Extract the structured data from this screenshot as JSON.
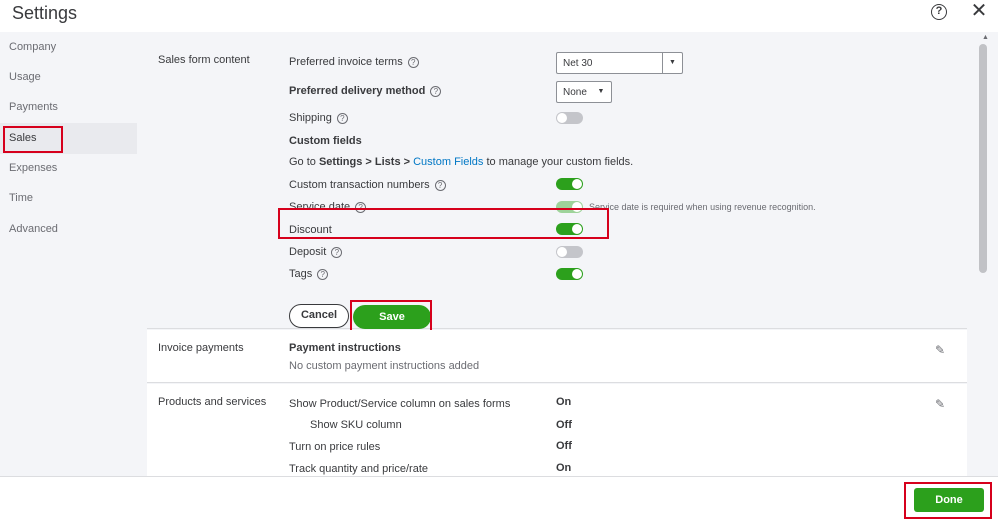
{
  "header": {
    "title": "Settings",
    "help_symbol": "?",
    "close_symbol": "✕"
  },
  "sidebar": {
    "items": [
      {
        "label": "Company"
      },
      {
        "label": "Usage"
      },
      {
        "label": "Payments"
      },
      {
        "label": "Sales"
      },
      {
        "label": "Expenses"
      },
      {
        "label": "Time"
      },
      {
        "label": "Advanced"
      }
    ],
    "active": "Sales"
  },
  "sales_form_content": {
    "title": "Sales form content",
    "preferred_invoice_terms": {
      "label": "Preferred invoice terms",
      "value": "Net 30"
    },
    "preferred_delivery_method": {
      "label": "Preferred delivery method",
      "value": "None"
    },
    "shipping": {
      "label": "Shipping",
      "on": false
    },
    "custom_fields_heading": "Custom fields",
    "custom_fields_note": {
      "prefix": "Go to ",
      "path": "Settings > Lists > ",
      "link": "Custom Fields",
      "suffix": " to manage your custom fields."
    },
    "custom_transaction_numbers": {
      "label": "Custom transaction numbers",
      "on": true
    },
    "service_date": {
      "label": "Service date",
      "on": true,
      "note": "Service date is required when using revenue recognition."
    },
    "discount": {
      "label": "Discount",
      "on": true
    },
    "deposit": {
      "label": "Deposit",
      "on": false
    },
    "tags": {
      "label": "Tags",
      "on": true
    },
    "cancel_label": "Cancel",
    "save_label": "Save"
  },
  "invoice_payments": {
    "title": "Invoice payments",
    "heading": "Payment instructions",
    "value": "No custom payment instructions added"
  },
  "products_and_services": {
    "title": "Products and services",
    "rows": [
      {
        "label": "Show Product/Service column on sales forms",
        "value": "On"
      },
      {
        "label": "Show SKU column",
        "value": "Off"
      },
      {
        "label": "Turn on price rules",
        "value": "Off"
      },
      {
        "label": "Track quantity and price/rate",
        "value": "On"
      }
    ]
  },
  "footer": {
    "done_label": "Done"
  },
  "colors": {
    "accent_green": "#2ca01c",
    "highlight_red": "#d6001c",
    "link_blue": "#0077c5"
  },
  "icons": {
    "help": "help-circle-icon",
    "close": "close-icon",
    "edit": "pencil-icon",
    "dropdown": "chevron-down-icon"
  }
}
